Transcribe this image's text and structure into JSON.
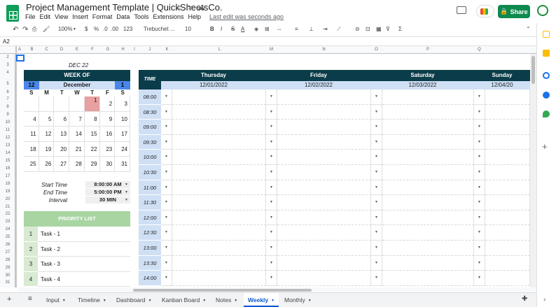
{
  "app": {
    "title": "Project Management Template | QuickSheetsCo.",
    "menu": [
      "File",
      "Edit",
      "View",
      "Insert",
      "Format",
      "Data",
      "Tools",
      "Extensions",
      "Help"
    ],
    "last_edit": "Last edit was seconds ago",
    "share_label": "Share",
    "accent": "#0f8a4f"
  },
  "toolbar": {
    "zoom": "100%",
    "currency": "$",
    "percent": "%",
    "dec_less": ".0",
    "dec_more": ".00",
    "format_more": "123",
    "font": "Trebuchet ...",
    "size": "10",
    "bold": "B",
    "italic": "I",
    "strike": "S",
    "text_color": "A"
  },
  "formula": {
    "namebox": "A2"
  },
  "columns": [
    "A",
    "B",
    "C",
    "D",
    "E",
    "F",
    "G",
    "H",
    "I",
    "J",
    "K",
    "L",
    "M",
    "N",
    "O",
    "P",
    "Q"
  ],
  "rows": [
    "2",
    "3",
    "4",
    "5",
    "6",
    "7",
    "8",
    "9",
    "10",
    "11",
    "12",
    "13",
    "14",
    "15",
    "16",
    "17",
    "18",
    "19",
    "20",
    "21",
    "22",
    "23",
    "24",
    "25",
    "26",
    "27",
    "28",
    "29",
    "30",
    "31"
  ],
  "calendar": {
    "date_label": "DEC 22",
    "week_of": "WEEK OF",
    "month_num": "12",
    "month_name": "December",
    "week_num": "1",
    "day_headers": [
      "S",
      "M",
      "T",
      "W",
      "T",
      "F",
      "S"
    ],
    "weeks": [
      [
        "",
        "",
        "",
        "",
        "1",
        "2",
        "3"
      ],
      [
        "4",
        "5",
        "6",
        "7",
        "8",
        "9",
        "10"
      ],
      [
        "11",
        "12",
        "13",
        "14",
        "15",
        "16",
        "17"
      ],
      [
        "18",
        "19",
        "20",
        "21",
        "22",
        "23",
        "24"
      ],
      [
        "25",
        "26",
        "27",
        "28",
        "29",
        "30",
        "31"
      ]
    ],
    "highlight": "#e8a0a0"
  },
  "time_settings": {
    "start_label": "Start Time",
    "start_value": "8:00:00 AM",
    "end_label": "End Time",
    "end_value": "5:00:00 PM",
    "interval_label": "Interval",
    "interval_value": "30 MIN"
  },
  "priority": {
    "title": "PRIORITY LIST",
    "items": [
      {
        "num": "1",
        "task": "Task - 1"
      },
      {
        "num": "2",
        "task": "Task - 2"
      },
      {
        "num": "3",
        "task": "Task - 3"
      },
      {
        "num": "4",
        "task": "Task - 4"
      }
    ]
  },
  "schedule": {
    "time_header": "TIME",
    "times": [
      "08:00",
      "08:30",
      "09:00",
      "09:30",
      "10:00",
      "10:30",
      "11:00",
      "11:30",
      "12:00",
      "12:30",
      "13:00",
      "13:30",
      "14:00"
    ],
    "days": [
      {
        "name": "Thursday",
        "date": "12/01/2022"
      },
      {
        "name": "Friday",
        "date": "12/02/2022"
      },
      {
        "name": "Saturday",
        "date": "12/03/2022"
      },
      {
        "name": "Sunday",
        "date": "12/04/20"
      }
    ],
    "header_color": "#0b3c49",
    "light_blue": "#cfe0f5"
  },
  "sheets": [
    "Input",
    "Timeline",
    "Dashboard",
    "Kanban Board",
    "Notes",
    "Weekly",
    "Monthly"
  ],
  "active_sheet": "Weekly"
}
